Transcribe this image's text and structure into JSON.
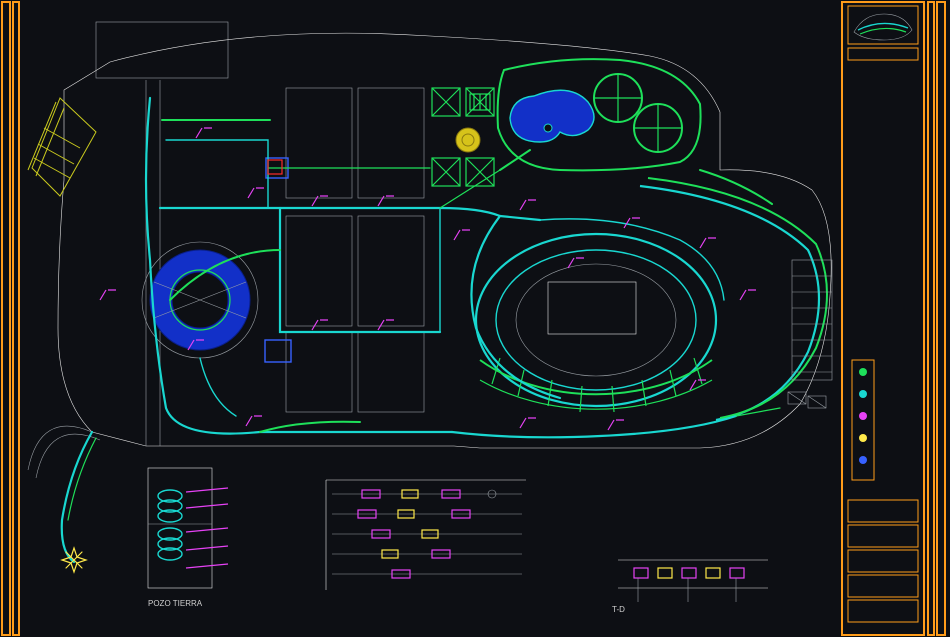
{
  "colors": {
    "frame": "#ff9c1a",
    "green": "#1ee05a",
    "cyan": "#19d7d0",
    "magenta": "#e642f5",
    "yellow": "#ffe94a",
    "blue": "#3761ff",
    "bluefill": "#1230c8",
    "bg": "#0d0f14"
  },
  "titleblock": {
    "rows": [
      "",
      "",
      "",
      "",
      ""
    ]
  },
  "legend": {
    "items": [
      {
        "swatch": "#1ee05a",
        "label": ""
      },
      {
        "swatch": "#19d7d0",
        "label": ""
      },
      {
        "swatch": "#e642f5",
        "label": ""
      },
      {
        "swatch": "#ffe94a",
        "label": ""
      },
      {
        "swatch": "#3761ff",
        "label": ""
      }
    ]
  },
  "details": {
    "d1": {
      "title": "POZO TIERRA",
      "subtitle": ""
    },
    "d2": {
      "title": "",
      "notes": [
        "",
        "",
        "",
        ""
      ]
    },
    "d3": {
      "title": "T-D"
    }
  },
  "annotations": {
    "redbox": "",
    "pipe_labels": [
      "",
      "",
      "",
      "",
      "",
      "",
      "",
      "",
      "",
      "",
      ""
    ]
  }
}
